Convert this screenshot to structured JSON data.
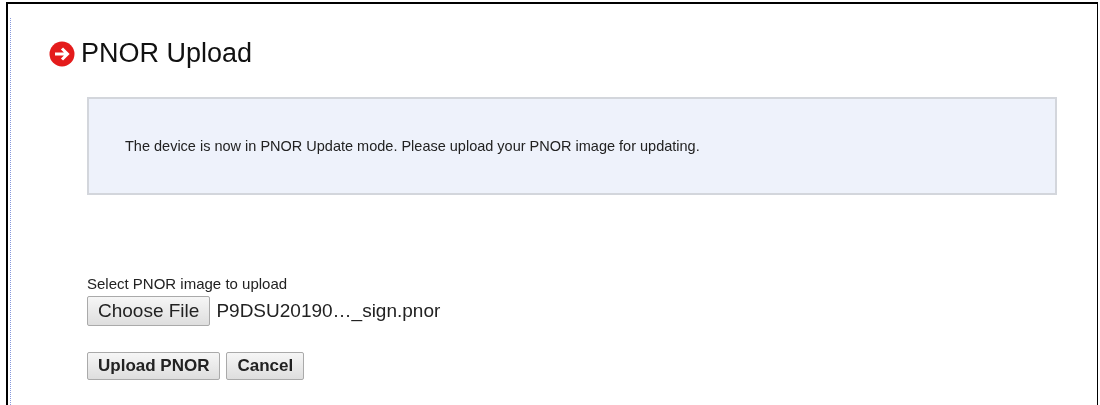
{
  "page": {
    "title": "PNOR Upload"
  },
  "notice": "The device is now in PNOR Update mode. Please upload your PNOR image for updating.",
  "file_picker": {
    "label": "Select PNOR image to upload",
    "button": "Choose File",
    "file_name": "P9DSU20190…_sign.pnor"
  },
  "buttons": [
    "Upload PNOR",
    "Cancel"
  ]
}
